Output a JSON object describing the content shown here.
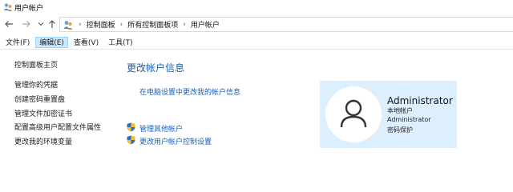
{
  "window": {
    "title": "用户帐户"
  },
  "nav": {
    "back_icon": "arrow-left-icon",
    "forward_icon": "arrow-right-icon",
    "recent_icon": "chevron-down-icon",
    "up_icon": "arrow-up-icon"
  },
  "address": {
    "crumbs": [
      "控制面板",
      "所有控制面板项",
      "用户帐户"
    ]
  },
  "menu": {
    "items": [
      "文件(F)",
      "编辑(E)",
      "查看(V)",
      "工具(T)"
    ],
    "active_index": 1
  },
  "sidebar": {
    "items": [
      "控制面板主页",
      "管理你的凭据",
      "创建密码重置盘",
      "管理文件加密证书",
      "配置高级用户配置文件属性",
      "更改我的环境变量"
    ]
  },
  "main": {
    "title": "更改帐户信息",
    "pc_settings_link": "在电脑设置中更改我的帐户信息",
    "manage_accounts_link": "管理其他帐户",
    "uac_link": "更改用户帐户控制设置"
  },
  "account": {
    "name": "Administrator",
    "type": "本地帐户",
    "group": "Administrator",
    "protection": "密码保护"
  },
  "colors": {
    "link": "#1a5fb4",
    "panel_bg": "#ddeefd",
    "menu_active_bg": "#cce8ff"
  }
}
